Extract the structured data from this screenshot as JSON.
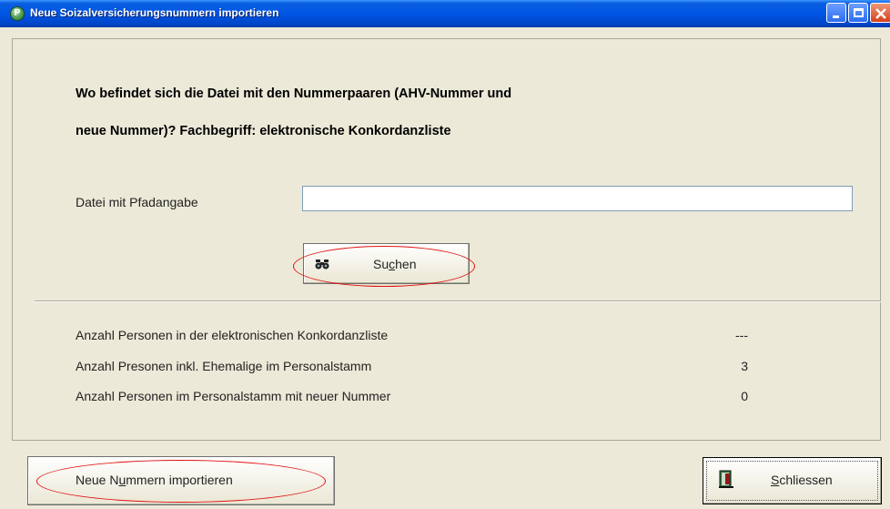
{
  "window": {
    "title": "Neue Soizalversicherungsnummern importieren",
    "icon_glyph": "P"
  },
  "intro": {
    "line1": "Wo befindet sich die Datei mit den Nummerpaaren (AHV-Nummer und",
    "line2": "neue Nummer)? Fachbegriff: elektronische Konkordanzliste"
  },
  "file": {
    "label": "Datei mit Pfadangabe",
    "value": "",
    "placeholder": ""
  },
  "search_button": {
    "label_pre": "Su",
    "label_ul": "c",
    "label_post": "hen",
    "icon": "binoculars-icon"
  },
  "stats": [
    {
      "label": "Anzahl Personen in der elektronischen Konkordanzliste",
      "value": "---"
    },
    {
      "label": "Anzahl Presonen inkl. Ehemalige im Personalstamm",
      "value": "3"
    },
    {
      "label": "Anzahl Personen im Personalstamm mit neuer Nummer",
      "value": "0"
    }
  ],
  "import_button": {
    "label_pre": "Neue N",
    "label_ul": "u",
    "label_post": "mmern importieren"
  },
  "close_button": {
    "label_pre": "",
    "label_ul": "S",
    "label_post": "chliessen",
    "icon": "exit-door-icon"
  },
  "colors": {
    "titlebar": "#0055e5",
    "window_bg": "#ece9d8",
    "highlight": "#e01010"
  }
}
